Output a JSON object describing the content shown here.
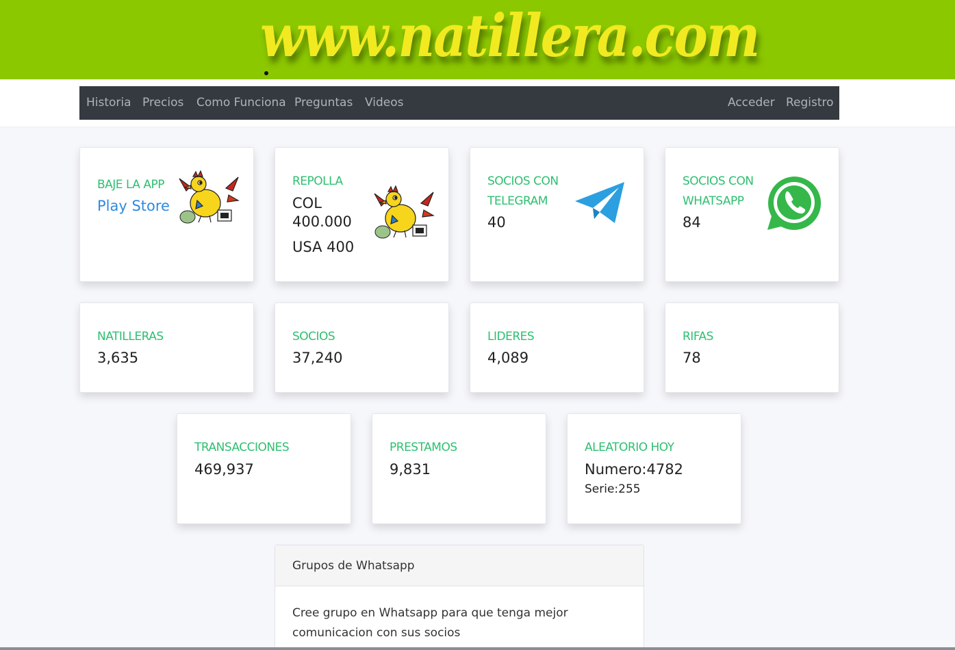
{
  "banner": {
    "logo_text": "www.natillera.com"
  },
  "nav": {
    "left": [
      "Historia",
      "Precios",
      "Como Funciona",
      "Preguntas",
      "Videos"
    ],
    "right": [
      "Acceder",
      "Registro"
    ]
  },
  "cards": {
    "app": {
      "title": "BAJE LA APP",
      "link": "Play Store"
    },
    "repolla": {
      "title": "REPOLLA",
      "line1": "COL",
      "line2": "400.000",
      "line3": "USA 400"
    },
    "telegram": {
      "title_line1": "SOCIOS CON",
      "title_line2": "TELEGRAM",
      "value": "40"
    },
    "whatsapp": {
      "title_line1": "SOCIOS CON",
      "title_line2": "WHATSAPP",
      "value": "84"
    },
    "natilleras": {
      "title": "NATILLERAS",
      "value": "3,635"
    },
    "socios": {
      "title": "SOCIOS",
      "value": "37,240"
    },
    "lideres": {
      "title": "LIDERES",
      "value": "4,089"
    },
    "rifas": {
      "title": "RIFAS",
      "value": "78"
    },
    "transacciones": {
      "title": "TRANSACCIONES",
      "value": "469,937"
    },
    "prestamos": {
      "title": "PRESTAMOS",
      "value": "9,831"
    },
    "aleatorio": {
      "title": "ALEATORIO HOY",
      "numero": "Numero:4782",
      "serie": "Serie:255"
    }
  },
  "groups": {
    "header": "Grupos de Whatsapp",
    "body": "Cree grupo en Whatsapp para que tenga mejor comunicacion con sus socios"
  },
  "colors": {
    "banner": "#8cc800",
    "logo": "#f1ea21",
    "navbar": "#343a40",
    "card_title": "#2ebf70",
    "link": "#2e8be0"
  }
}
